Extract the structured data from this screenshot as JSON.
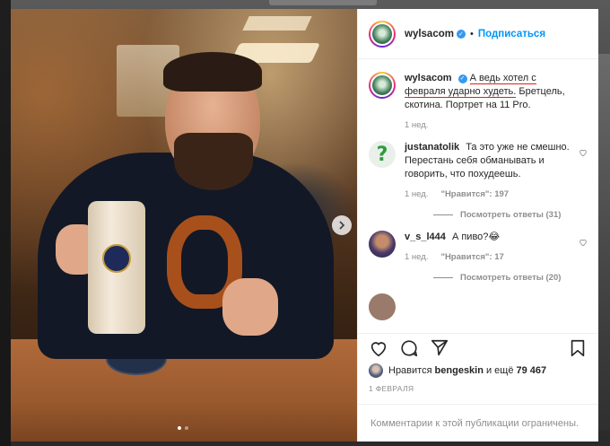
{
  "post": {
    "author": "wylsacom",
    "separator": "•",
    "follow_label": "Подписаться"
  },
  "caption": {
    "author": "wylsacom",
    "text_highlight": "А ведь хотел с февраля ударно худеть.",
    "text_rest": " Бретцель, скотина. Портрет на 11 Pro.",
    "time": "1 нед."
  },
  "comments": [
    {
      "user": "justanatolik",
      "text": "Та это уже не смешно. Перестань себя обманывать и говорить, что похудеешь.",
      "time": "1 нед.",
      "likes": "\"Нравится\": 197",
      "replies": "Посмотреть ответы (31)"
    },
    {
      "user": "v_s_l444",
      "text": "А пиво?😂",
      "time": "1 нед.",
      "likes": "\"Нравится\": 17",
      "replies": "Посмотреть ответы (20)"
    }
  ],
  "likes_line": {
    "prefix": "Нравится ",
    "user": "bengeskin",
    "suffix_prefix": " и ещё ",
    "count": "79 467"
  },
  "post_date": "1 ФЕВРАЛЯ",
  "footer_text": "Комментарии к этой публикации ограничены.",
  "carousel": {
    "total": 2,
    "active": 1
  },
  "colors": {
    "accent": "#0095f6",
    "verified": "#3897f0",
    "highlight_underline": "#e0201c",
    "muted": "#8e8e8e"
  },
  "icons": [
    "heart-icon",
    "comment-icon",
    "share-icon",
    "bookmark-icon",
    "chevron-right-icon",
    "verified-badge-icon"
  ]
}
